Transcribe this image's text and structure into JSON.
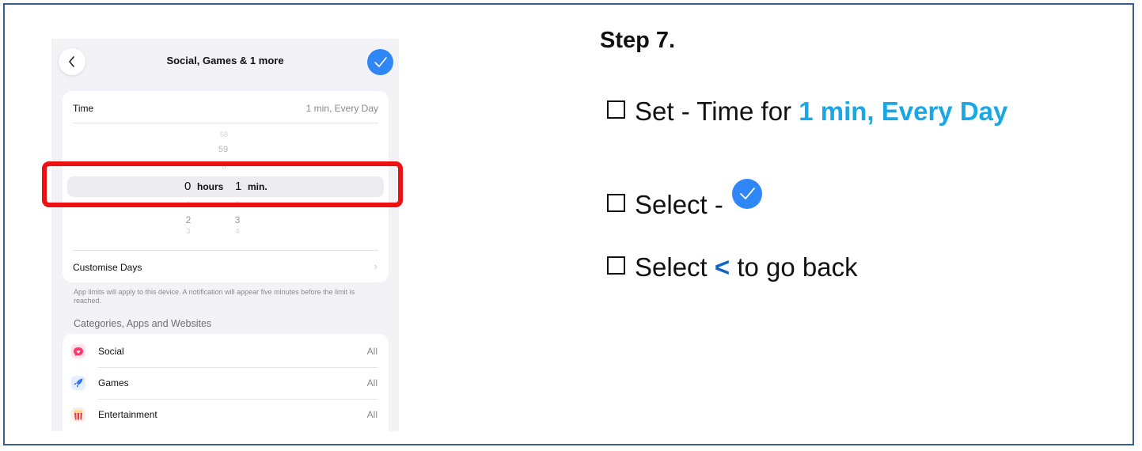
{
  "phone": {
    "nav_title": "Social, Games & 1 more",
    "time_label": "Time",
    "time_value": "1 min, Every Day",
    "picker": {
      "minutes_above": [
        "58",
        "59",
        "0"
      ],
      "hours_below": [
        "1",
        "2",
        "3"
      ],
      "minutes_below": [
        "2",
        "3",
        "4"
      ],
      "selected_hours": "0",
      "hours_label": "hours",
      "selected_minutes": "1",
      "minutes_label": "min."
    },
    "customise_days": "Customise Days",
    "footnote": "App limits will apply to this device. A notification will appear five minutes before the limit is reached.",
    "section_header": "Categories, Apps and Websites",
    "apps": [
      {
        "name": "Social",
        "value": "All",
        "icon": "speech-bubble-heart-icon",
        "color": "#ff3b6b"
      },
      {
        "name": "Games",
        "value": "All",
        "icon": "rocket-icon",
        "color": "#3478f6"
      },
      {
        "name": "Entertainment",
        "value": "All",
        "icon": "popcorn-icon",
        "color": "#e53935"
      }
    ],
    "accent": "#2f86f6"
  },
  "instructions": {
    "step_title": "Step 7.",
    "line1_prefix": "Set - Time for ",
    "line1_highlight": "1 min, Every Day",
    "line2_prefix": "Select - ",
    "line3_prefix": "Select ",
    "line3_symbol": "<",
    "line3_suffix": " to go back",
    "highlight_color": "#1aa7e6",
    "annotation_color": "#ee1111"
  }
}
